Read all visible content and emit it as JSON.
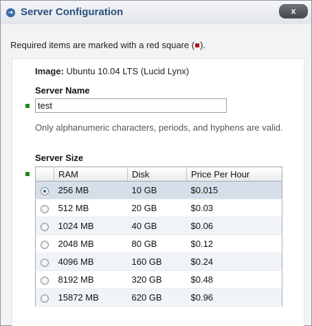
{
  "dialog": {
    "title": "Server Configuration",
    "close_label": "x",
    "title_icon": "arrow-right-circle-icon"
  },
  "required_note": {
    "before": "Required items are marked with a red square (",
    "after": ")."
  },
  "image": {
    "label": "Image:",
    "value": "Ubuntu 10.04 LTS (Lucid Lynx)"
  },
  "server_name": {
    "label": "Server Name",
    "value": "test",
    "hint": "Only alphanumeric characters, periods, and hyphens are valid."
  },
  "server_size": {
    "label": "Server Size",
    "columns": [
      "RAM",
      "Disk",
      "Price Per Hour"
    ],
    "rows": [
      {
        "ram": "256 MB",
        "disk": "10 GB",
        "price": "$0.015",
        "selected": true
      },
      {
        "ram": "512 MB",
        "disk": "20 GB",
        "price": "$0.03",
        "selected": false
      },
      {
        "ram": "1024 MB",
        "disk": "40 GB",
        "price": "$0.06",
        "selected": false
      },
      {
        "ram": "2048 MB",
        "disk": "80 GB",
        "price": "$0.12",
        "selected": false
      },
      {
        "ram": "4096 MB",
        "disk": "160 GB",
        "price": "$0.24",
        "selected": false
      },
      {
        "ram": "8192 MB",
        "disk": "320 GB",
        "price": "$0.48",
        "selected": false
      },
      {
        "ram": "15872 MB",
        "disk": "620 GB",
        "price": "$0.96",
        "selected": false
      }
    ]
  },
  "colors": {
    "title_text": "#2b4f7e",
    "required_marker": "#b01818",
    "field_marker": "#1d8a1d",
    "selected_row": "#d6deea"
  }
}
